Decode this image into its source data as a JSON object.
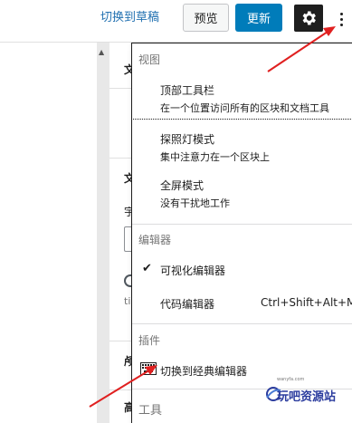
{
  "toolbar": {
    "switch_to_draft": "切换到草稿",
    "preview_label": "预览",
    "update_label": "更新",
    "accent_color": "#007cba"
  },
  "sidebar_fragments": {
    "frag_1": "文",
    "frag_2": "文",
    "frag_3": "宇",
    "frag_4": "ti",
    "frag_5": "颅",
    "frag_6": "高"
  },
  "menu": {
    "view_group": {
      "label": "视图",
      "items": [
        {
          "title": "顶部工具栏",
          "description": "在一个位置访问所有的区块和文档工具"
        },
        {
          "title": "探照灯模式",
          "description": "集中注意力在一个区块上"
        },
        {
          "title": "全屏模式",
          "description": "没有干扰地工作"
        }
      ]
    },
    "editor_group": {
      "label": "编辑器",
      "items": [
        {
          "title": "可视化编辑器",
          "selected": true,
          "check": "✔"
        },
        {
          "title": "代码编辑器",
          "shortcut": "Ctrl+Shift+Alt+M"
        }
      ]
    },
    "plugins_group": {
      "label": "插件",
      "items": [
        {
          "title": "切换到经典编辑器",
          "icon": "keyboard-icon"
        }
      ]
    },
    "tools_group": {
      "label": "工具"
    }
  },
  "watermark": {
    "url": "wanyfa.com",
    "text": "玩吧资源站"
  },
  "annotation_color": "#e02020"
}
